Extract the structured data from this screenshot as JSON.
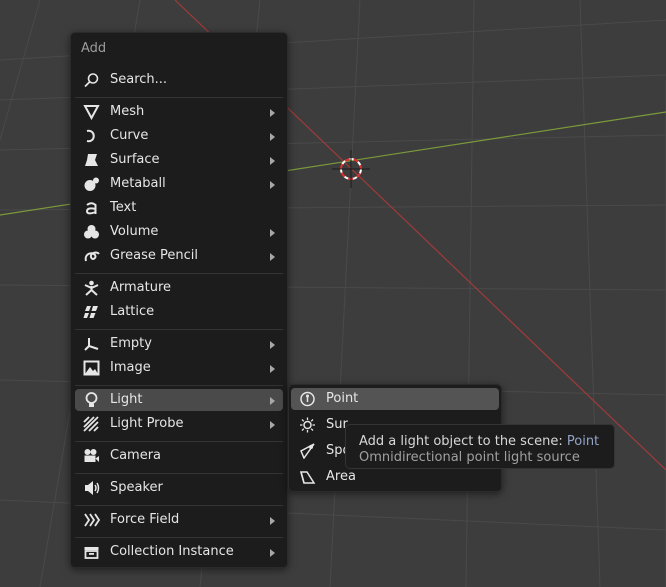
{
  "viewport": {
    "background": "#3d3d3d",
    "x_axis_color": "#7c9a3a",
    "y_axis_color": "#a13a3a",
    "grid_color": "#4a4a4a"
  },
  "menu": {
    "title": "Add",
    "items": [
      {
        "label": "Search...",
        "icon": "search-icon",
        "submenu": false
      },
      {
        "label": "Mesh",
        "icon": "mesh-icon",
        "submenu": true
      },
      {
        "label": "Curve",
        "icon": "curve-icon",
        "submenu": true
      },
      {
        "label": "Surface",
        "icon": "surface-icon",
        "submenu": true
      },
      {
        "label": "Metaball",
        "icon": "metaball-icon",
        "submenu": true
      },
      {
        "label": "Text",
        "icon": "text-icon",
        "submenu": false
      },
      {
        "label": "Volume",
        "icon": "volume-icon",
        "submenu": true
      },
      {
        "label": "Grease Pencil",
        "icon": "grease-pencil-icon",
        "submenu": true
      },
      {
        "label": "Armature",
        "icon": "armature-icon",
        "submenu": false
      },
      {
        "label": "Lattice",
        "icon": "lattice-icon",
        "submenu": false
      },
      {
        "label": "Empty",
        "icon": "empty-icon",
        "submenu": true
      },
      {
        "label": "Image",
        "icon": "image-icon",
        "submenu": true
      },
      {
        "label": "Light",
        "icon": "light-icon",
        "submenu": true,
        "active": true
      },
      {
        "label": "Light Probe",
        "icon": "light-probe-icon",
        "submenu": true
      },
      {
        "label": "Camera",
        "icon": "camera-icon",
        "submenu": false
      },
      {
        "label": "Speaker",
        "icon": "speaker-icon",
        "submenu": false
      },
      {
        "label": "Force Field",
        "icon": "force-field-icon",
        "submenu": true
      },
      {
        "label": "Collection Instance",
        "icon": "collection-instance-icon",
        "submenu": true
      }
    ]
  },
  "light_submenu": {
    "items": [
      {
        "label": "Point",
        "icon": "point-light-icon",
        "active": true
      },
      {
        "label": "Sun",
        "icon": "sun-light-icon"
      },
      {
        "label": "Spot",
        "icon": "spot-light-icon"
      },
      {
        "label": "Area",
        "icon": "area-light-icon"
      }
    ],
    "visible_labels": [
      "Point",
      "Sur",
      "Spo",
      "Area"
    ]
  },
  "tooltip": {
    "prefix": "Add a light object to the scene:",
    "accent": "Point",
    "description": "Omnidirectional point light source",
    "accent_color": "#93a3c8"
  }
}
